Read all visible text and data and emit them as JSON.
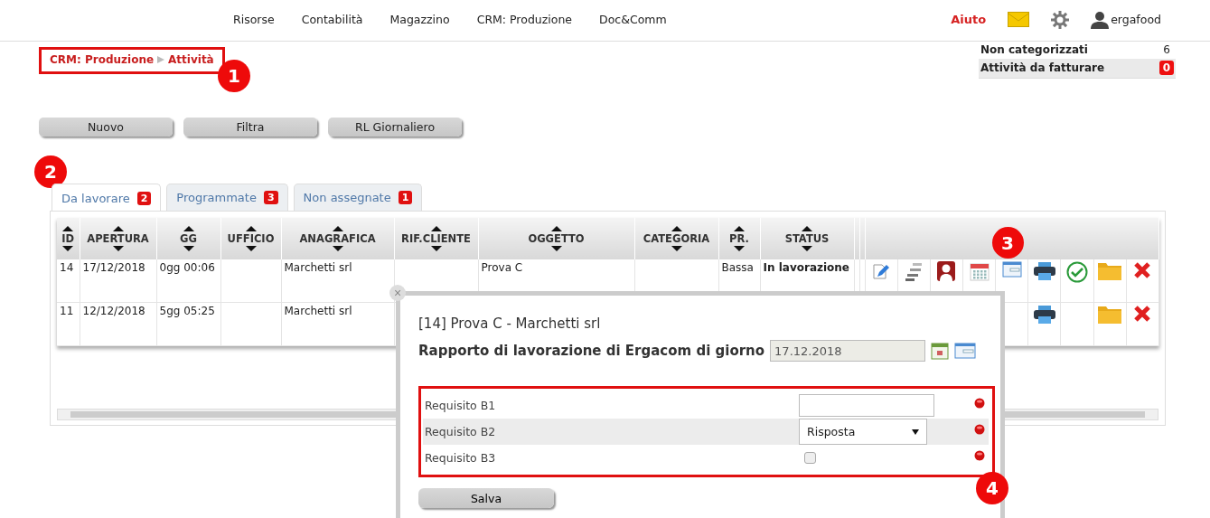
{
  "nav": {
    "items": [
      {
        "label": "Risorse"
      },
      {
        "label": "Contabilità"
      },
      {
        "label": "Magazzino"
      },
      {
        "label": "CRM: Produzione"
      },
      {
        "label": "Doc&Comm"
      }
    ],
    "help": "Aiuto",
    "user": "ergafood"
  },
  "breadcrumb": {
    "items": [
      "CRM: Produzione",
      "Attività"
    ],
    "callout": "1"
  },
  "summary": [
    {
      "label": "Non categorizzati",
      "count": "6",
      "alert": false
    },
    {
      "label": "Attività da fatturare",
      "count": "0",
      "alert": true
    }
  ],
  "buttons": [
    "Nuovo",
    "Filtra",
    "RL Giornaliero"
  ],
  "tabs_callout": "2",
  "tabs": [
    {
      "label": "Da lavorare",
      "count": "2",
      "selected": true
    },
    {
      "label": "Programmate",
      "count": "3",
      "selected": false
    },
    {
      "label": "Non assegnate",
      "count": "1",
      "selected": false
    }
  ],
  "table": {
    "columns": [
      "ID",
      "APERTURA",
      "GG",
      "UFFICIO",
      "ANAGRAFICA",
      "RIF.CLIENTE",
      "OGGETTO",
      "CATEGORIA",
      "PR.",
      "STATUS"
    ],
    "callout": "3",
    "rows": [
      {
        "cells": [
          "14",
          "17/12/2018",
          "0gg 00:06",
          "",
          "Marchetti srl",
          "",
          "Prova C",
          "",
          "Bassa",
          "In lavorazione"
        ],
        "actions": [
          {
            "kind": "edit"
          },
          {
            "kind": "list"
          },
          {
            "kind": "person"
          },
          {
            "kind": "calendar"
          },
          {
            "kind": "form"
          },
          {
            "kind": "print"
          },
          {
            "kind": "done"
          },
          {
            "kind": "folder"
          },
          {
            "kind": "delete"
          }
        ]
      },
      {
        "cells": [
          "11",
          "12/12/2018",
          "5gg 05:25",
          "",
          "Marchetti srl",
          "",
          "",
          "",
          "",
          ""
        ],
        "actions": [
          {
            "kind": "empty"
          },
          {
            "kind": "empty"
          },
          {
            "kind": "empty"
          },
          {
            "kind": "empty"
          },
          {
            "kind": "empty"
          },
          {
            "kind": "print"
          },
          {
            "kind": "empty"
          },
          {
            "kind": "folder"
          },
          {
            "kind": "delete"
          }
        ]
      }
    ]
  },
  "popup": {
    "close": "×",
    "title": "[14] Prova C - Marchetti srl",
    "report_label": "Rapporto di lavorazione di Ergacom di giorno",
    "date": "17.12.2018",
    "requirements": [
      {
        "label": "Requisito B1",
        "kind": "text"
      },
      {
        "label": "Requisito B2",
        "kind": "select",
        "value": "Risposta"
      },
      {
        "label": "Requisito B3",
        "kind": "checkbox",
        "checked": false
      }
    ],
    "requirements_callout": "4",
    "save": "Salva"
  }
}
